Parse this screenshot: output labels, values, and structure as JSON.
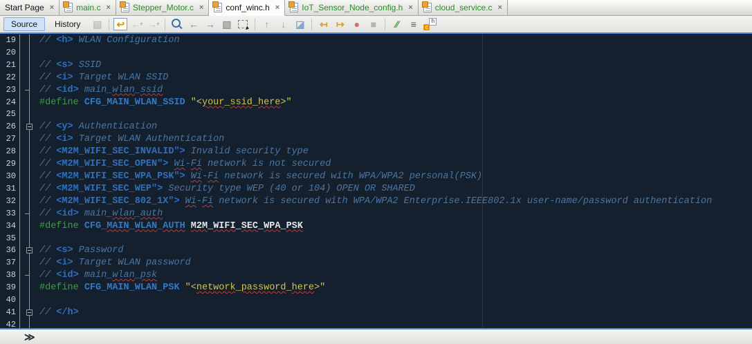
{
  "tabbar": {
    "close_glyph": "×",
    "tabs": [
      {
        "label": "Start Page",
        "icon": null,
        "active": false,
        "modified": false
      },
      {
        "label": "main.c",
        "icon": "c-file-icon",
        "active": false,
        "modified": true
      },
      {
        "label": "Stepper_Motor.c",
        "icon": "c-file-icon",
        "active": false,
        "modified": true
      },
      {
        "label": "conf_winc.h",
        "icon": "header-file-icon",
        "active": true,
        "modified": false
      },
      {
        "label": "IoT_Sensor_Node_config.h",
        "icon": "header-file-icon",
        "active": false,
        "modified": true
      },
      {
        "label": "cloud_service.c",
        "icon": "c-file-icon",
        "active": false,
        "modified": true
      }
    ]
  },
  "toolbar": {
    "source_label": "Source",
    "history_label": "History",
    "icons": [
      {
        "type": "icon",
        "name": "diff-icon",
        "glyph": "▤",
        "color": "#8a8a84",
        "enabled": false
      },
      {
        "type": "sep"
      },
      {
        "type": "icon",
        "name": "last-edit-position-icon",
        "glyph": "↩",
        "color": "#d8920a",
        "kind": "last-edit",
        "enabled": true
      },
      {
        "type": "icon",
        "name": "back-icon",
        "glyph": "←",
        "color": "#8a8a84",
        "enabled": false,
        "dropdown": true
      },
      {
        "type": "icon",
        "name": "forward-icon",
        "glyph": "→",
        "color": "#8a8a84",
        "enabled": false,
        "dropdown": true
      },
      {
        "type": "sep"
      },
      {
        "type": "icon",
        "name": "find-selection-icon",
        "glyph": "",
        "kind": "magnifier",
        "enabled": true
      },
      {
        "type": "icon",
        "name": "find-previous-occurrence-icon",
        "glyph": "←",
        "color": "#4d8fd6",
        "enabled": true
      },
      {
        "type": "icon",
        "name": "find-next-occurrence-icon",
        "glyph": "→",
        "color": "#4d8fd6",
        "enabled": true
      },
      {
        "type": "icon",
        "name": "toggle-highlight-search-icon",
        "glyph": "▧",
        "color": "#9a9a94",
        "enabled": true
      },
      {
        "type": "icon",
        "name": "rectangular-selection-icon",
        "glyph": "",
        "kind": "dashed-box",
        "enabled": true
      },
      {
        "type": "sep"
      },
      {
        "type": "icon",
        "name": "previous-bookmark-icon",
        "glyph": "↑",
        "color": "#e09a28",
        "enabled": true
      },
      {
        "type": "icon",
        "name": "next-bookmark-icon",
        "glyph": "↓",
        "color": "#e09a28",
        "enabled": true
      },
      {
        "type": "icon",
        "name": "toggle-bookmark-icon",
        "glyph": "◪",
        "color": "#7fa7d0",
        "enabled": true
      },
      {
        "type": "sep"
      },
      {
        "type": "icon",
        "name": "shift-line-left-icon",
        "glyph": "↤",
        "color": "#e09a28",
        "enabled": true
      },
      {
        "type": "icon",
        "name": "shift-line-right-icon",
        "glyph": "↦",
        "color": "#e09a28",
        "enabled": true
      },
      {
        "type": "icon",
        "name": "start-macro-recording-icon",
        "glyph": "●",
        "color": "#d96a6a",
        "enabled": true
      },
      {
        "type": "icon",
        "name": "stop-macro-recording-icon",
        "glyph": "■",
        "color": "#b3b3ac",
        "enabled": true
      },
      {
        "type": "sep"
      },
      {
        "type": "icon",
        "name": "comment-icon",
        "glyph": "∕∕",
        "color": "#3f9b43",
        "enabled": true
      },
      {
        "type": "icon",
        "name": "uncomment-icon",
        "glyph": "≡",
        "color": "#55555a",
        "enabled": true
      },
      {
        "type": "icon",
        "name": "toggle-header-source-icon",
        "glyph": "",
        "kind": "c-h-file",
        "enabled": true
      }
    ]
  },
  "editor": {
    "margin_column": 80,
    "lines": [
      {
        "n": 19,
        "f": null,
        "t": [
          [
            "c",
            "// "
          ],
          [
            "t",
            "<h>"
          ],
          [
            "c",
            " WLAN Configuration"
          ]
        ]
      },
      {
        "n": 20,
        "f": null,
        "t": []
      },
      {
        "n": 21,
        "f": null,
        "t": [
          [
            "c",
            "// "
          ],
          [
            "t",
            "<s>"
          ],
          [
            "c",
            " SSID"
          ]
        ]
      },
      {
        "n": 22,
        "f": null,
        "t": [
          [
            "c",
            "// "
          ],
          [
            "t",
            "<i>"
          ],
          [
            "c",
            " Target WLAN SSID"
          ]
        ]
      },
      {
        "n": 23,
        "f": "tick",
        "t": [
          [
            "c",
            "// "
          ],
          [
            "t",
            "<id>"
          ],
          [
            "c",
            " main_"
          ],
          [
            "c sq",
            "wlan"
          ],
          [
            "c",
            "_"
          ],
          [
            "c sq",
            "ssid"
          ]
        ]
      },
      {
        "n": 24,
        "f": null,
        "t": [
          [
            "p",
            "#define"
          ],
          [
            "x",
            " "
          ],
          [
            "m",
            "CFG_MAIN_WLAN_SSID"
          ],
          [
            "x",
            " "
          ],
          [
            "s",
            "\"<"
          ],
          [
            "s sq",
            "your"
          ],
          [
            "s",
            "_"
          ],
          [
            "s sq",
            "ssid"
          ],
          [
            "s",
            "_"
          ],
          [
            "s sq",
            "here"
          ],
          [
            "s",
            ">\""
          ]
        ]
      },
      {
        "n": 25,
        "f": null,
        "t": []
      },
      {
        "n": 26,
        "f": "box",
        "t": [
          [
            "c",
            "// "
          ],
          [
            "t",
            "<y>"
          ],
          [
            "c",
            " Authentication"
          ]
        ]
      },
      {
        "n": 27,
        "f": null,
        "t": [
          [
            "c",
            "// "
          ],
          [
            "t",
            "<i>"
          ],
          [
            "c",
            " Target WLAN Authentication"
          ]
        ]
      },
      {
        "n": 28,
        "f": null,
        "t": [
          [
            "c",
            "// "
          ],
          [
            "t",
            "<M2M_WIFI_SEC_INVALID\">"
          ],
          [
            "c",
            " Invalid security type"
          ]
        ]
      },
      {
        "n": 29,
        "f": null,
        "t": [
          [
            "c",
            "// "
          ],
          [
            "t",
            "<M2M_WIFI_SEC_OPEN\">"
          ],
          [
            "c",
            " "
          ],
          [
            "c sq",
            "Wi"
          ],
          [
            "c",
            "-"
          ],
          [
            "c sq",
            "Fi"
          ],
          [
            "c",
            " network is not secured"
          ]
        ]
      },
      {
        "n": 30,
        "f": null,
        "t": [
          [
            "c",
            "// "
          ],
          [
            "t",
            "<M2M_WIFI_SEC_WPA_PSK\">"
          ],
          [
            "c",
            " "
          ],
          [
            "c sq",
            "Wi"
          ],
          [
            "c",
            "-"
          ],
          [
            "c sq",
            "Fi"
          ],
          [
            "c",
            " network is secured with WPA/WPA2 personal(PSK)"
          ]
        ]
      },
      {
        "n": 31,
        "f": null,
        "t": [
          [
            "c",
            "// "
          ],
          [
            "t",
            "<M2M_WIFI_SEC_WEP\">"
          ],
          [
            "c",
            " Security type WEP (40 or 104) OPEN OR SHARED"
          ]
        ]
      },
      {
        "n": 32,
        "f": null,
        "t": [
          [
            "c",
            "// "
          ],
          [
            "t",
            "<M2M_WIFI_SEC_802_1X\">"
          ],
          [
            "c",
            " "
          ],
          [
            "c sq",
            "Wi"
          ],
          [
            "c",
            "-"
          ],
          [
            "c sq",
            "Fi"
          ],
          [
            "c",
            " network is secured with WPA/WPA2 Enterprise.IEEE802.1x user-name/password authentication"
          ]
        ]
      },
      {
        "n": 33,
        "f": "tick",
        "t": [
          [
            "c",
            "// "
          ],
          [
            "t",
            "<id>"
          ],
          [
            "c",
            " main_"
          ],
          [
            "c sq",
            "wlan"
          ],
          [
            "c",
            "_"
          ],
          [
            "c sq",
            "auth"
          ]
        ]
      },
      {
        "n": 34,
        "f": null,
        "t": [
          [
            "p",
            "#define"
          ],
          [
            "x",
            " "
          ],
          [
            "m",
            "CFG_"
          ],
          [
            "m sq",
            "MAIN"
          ],
          [
            "m",
            "_"
          ],
          [
            "m sq",
            "WLAN"
          ],
          [
            "m",
            "_"
          ],
          [
            "m sq",
            "AUTH"
          ],
          [
            "x",
            " "
          ],
          [
            "v sq",
            "M2M"
          ],
          [
            "v",
            "_"
          ],
          [
            "v sq",
            "WIFI"
          ],
          [
            "v",
            "_"
          ],
          [
            "v sq",
            "SEC"
          ],
          [
            "v",
            "_"
          ],
          [
            "v sq",
            "WPA"
          ],
          [
            "v",
            "_"
          ],
          [
            "v sq",
            "PSK"
          ]
        ]
      },
      {
        "n": 35,
        "f": null,
        "t": []
      },
      {
        "n": 36,
        "f": "box",
        "t": [
          [
            "c",
            "// "
          ],
          [
            "t",
            "<s>"
          ],
          [
            "c",
            " Password"
          ]
        ]
      },
      {
        "n": 37,
        "f": null,
        "t": [
          [
            "c",
            "// "
          ],
          [
            "t",
            "<i>"
          ],
          [
            "c",
            " Target WLAN password"
          ]
        ]
      },
      {
        "n": 38,
        "f": "tick",
        "t": [
          [
            "c",
            "// "
          ],
          [
            "t",
            "<id>"
          ],
          [
            "c",
            " main_"
          ],
          [
            "c sq",
            "wlan"
          ],
          [
            "c",
            "_"
          ],
          [
            "c sq",
            "psk"
          ]
        ]
      },
      {
        "n": 39,
        "f": null,
        "t": [
          [
            "p",
            "#define"
          ],
          [
            "x",
            " "
          ],
          [
            "m",
            "CFG_MAIN_WLAN_PSK"
          ],
          [
            "x",
            " "
          ],
          [
            "s",
            "\"<"
          ],
          [
            "s sq",
            "network"
          ],
          [
            "s",
            "_"
          ],
          [
            "s sq",
            "password"
          ],
          [
            "s",
            "_"
          ],
          [
            "s sq",
            "here"
          ],
          [
            "s",
            ">\""
          ]
        ]
      },
      {
        "n": 40,
        "f": null,
        "t": []
      },
      {
        "n": 41,
        "f": "box",
        "t": [
          [
            "c",
            "// "
          ],
          [
            "t",
            "</h>"
          ]
        ]
      },
      {
        "n": 42,
        "f": null,
        "t": []
      }
    ]
  },
  "breadcrumb": {
    "chevron_glyph": "≫"
  },
  "colors": {
    "editor_background": "#14202E",
    "focus_border": "#4E88D4",
    "comment": "#4A76A4",
    "comment_tag": "#2F6FC0",
    "preprocessor": "#3F9B43",
    "macro": "#3579C4",
    "macro_value": "#E4E7EA",
    "string": "#D5C44C",
    "line_number": "#CDD3D9",
    "modified_tab": "#2C8A2C",
    "error_squiggle": "#C23B3B",
    "gutter_line": "#8D98A3"
  }
}
